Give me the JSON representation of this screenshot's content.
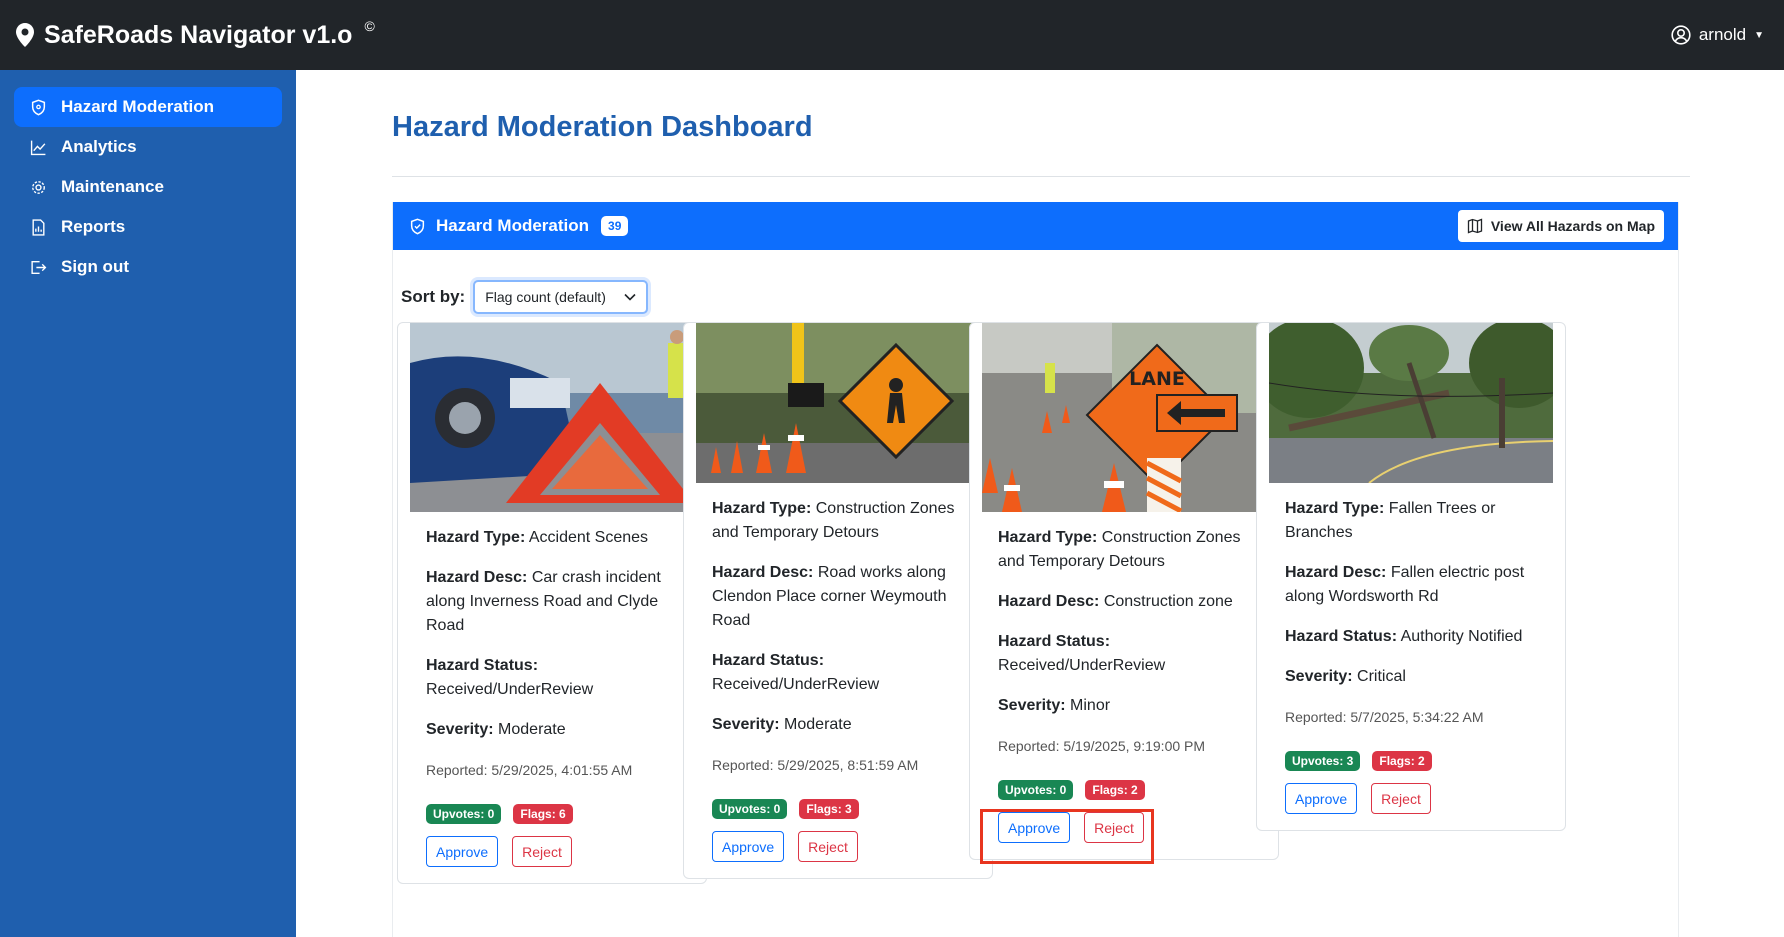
{
  "app": {
    "title": "SafeRoads Navigator v1.o",
    "title_sup": "©"
  },
  "user": {
    "name": "arnold"
  },
  "sidebar": {
    "items": [
      {
        "label": "Hazard Moderation",
        "icon": "shield-icon",
        "active": true
      },
      {
        "label": "Analytics",
        "icon": "chart-line-icon"
      },
      {
        "label": "Maintenance",
        "icon": "gear-icon"
      },
      {
        "label": "Reports",
        "icon": "report-icon"
      },
      {
        "label": "Sign out",
        "icon": "sign-out-icon"
      }
    ]
  },
  "main": {
    "title": "Hazard Moderation Dashboard",
    "panel": {
      "title": "Hazard Moderation",
      "count": "39",
      "map_button": "View All Hazards on Map"
    },
    "sort": {
      "label": "Sort by:",
      "selected": "Flag count (default)"
    }
  },
  "labels": {
    "type": "Hazard Type:",
    "desc": "Hazard Desc:",
    "status": "Hazard Status:",
    "severity": "Severity:",
    "approve": "Approve",
    "reject": "Reject"
  },
  "cards": [
    {
      "type": "Accident Scenes",
      "desc": "Car crash incident along Inverness Road and Clyde Road",
      "status": "Received/UnderReview",
      "severity": "Moderate",
      "reported": "Reported: 5/29/2025, 4:01:55 AM",
      "upvotes": "Upvotes: 0",
      "flags": "Flags: 6",
      "image": "car-crash-warning-triangle"
    },
    {
      "type": "Construction Zones and Temporary Detours",
      "desc": "Road works along Clendon Place corner Weymouth Road",
      "status": "Received/UnderReview",
      "severity": "Moderate",
      "reported": "Reported: 5/29/2025, 8:51:59 AM",
      "upvotes": "Upvotes: 0",
      "flags": "Flags: 3",
      "image": "road-work-sign-cones"
    },
    {
      "type": "Construction Zones and Temporary Detours",
      "desc": "Construction zone",
      "status": "Received/UnderReview",
      "severity": "Minor",
      "reported": "Reported: 5/19/2025, 9:19:00 PM",
      "upvotes": "Upvotes: 0",
      "flags": "Flags: 2",
      "image": "lane-closed-sign-cones"
    },
    {
      "type": "Fallen Trees or Branches",
      "desc": "Fallen electric post along Wordsworth Rd",
      "status": "Authority Notified",
      "severity": "Critical",
      "reported": "Reported: 5/7/2025, 5:34:22 AM",
      "upvotes": "Upvotes: 3",
      "flags": "Flags: 2",
      "image": "fallen-electric-post"
    }
  ],
  "colors": {
    "topbar": "#212529",
    "sidebar": "#1f5fae",
    "accent": "#0d6efd",
    "title": "#1f5fae",
    "success": "#198754",
    "danger": "#dc3545",
    "highlight": "#e8351f"
  }
}
